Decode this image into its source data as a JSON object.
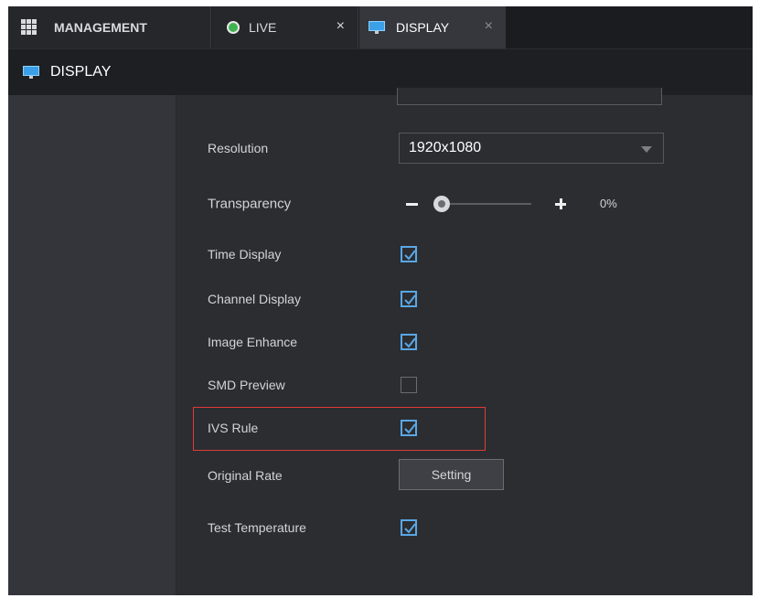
{
  "tabs": {
    "management": {
      "label": "MANAGEMENT"
    },
    "live": {
      "label": "LIVE",
      "close": "×"
    },
    "display": {
      "label": "DISPLAY",
      "close": "×"
    }
  },
  "page": {
    "title": "DISPLAY"
  },
  "settings": {
    "resolution": {
      "label": "Resolution",
      "value": "1920x1080"
    },
    "transparency": {
      "label": "Transparency",
      "value": "0%",
      "level_percent": 0
    },
    "time_display": {
      "label": "Time Display",
      "checked": true
    },
    "channel_display": {
      "label": "Channel Display",
      "checked": true
    },
    "image_enhance": {
      "label": "Image Enhance",
      "checked": true
    },
    "smd_preview": {
      "label": "SMD Preview",
      "checked": false
    },
    "ivs_rule": {
      "label": "IVS Rule",
      "checked": true
    },
    "original_rate": {
      "label": "Original Rate",
      "button": "Setting"
    },
    "test_temperature": {
      "label": "Test Temperature",
      "checked": true
    }
  },
  "colors": {
    "accent": "#3aa1e8",
    "checkbox": "#5aa7e5",
    "highlight": "#e03a3a",
    "live_dot": "#3fb34f"
  }
}
